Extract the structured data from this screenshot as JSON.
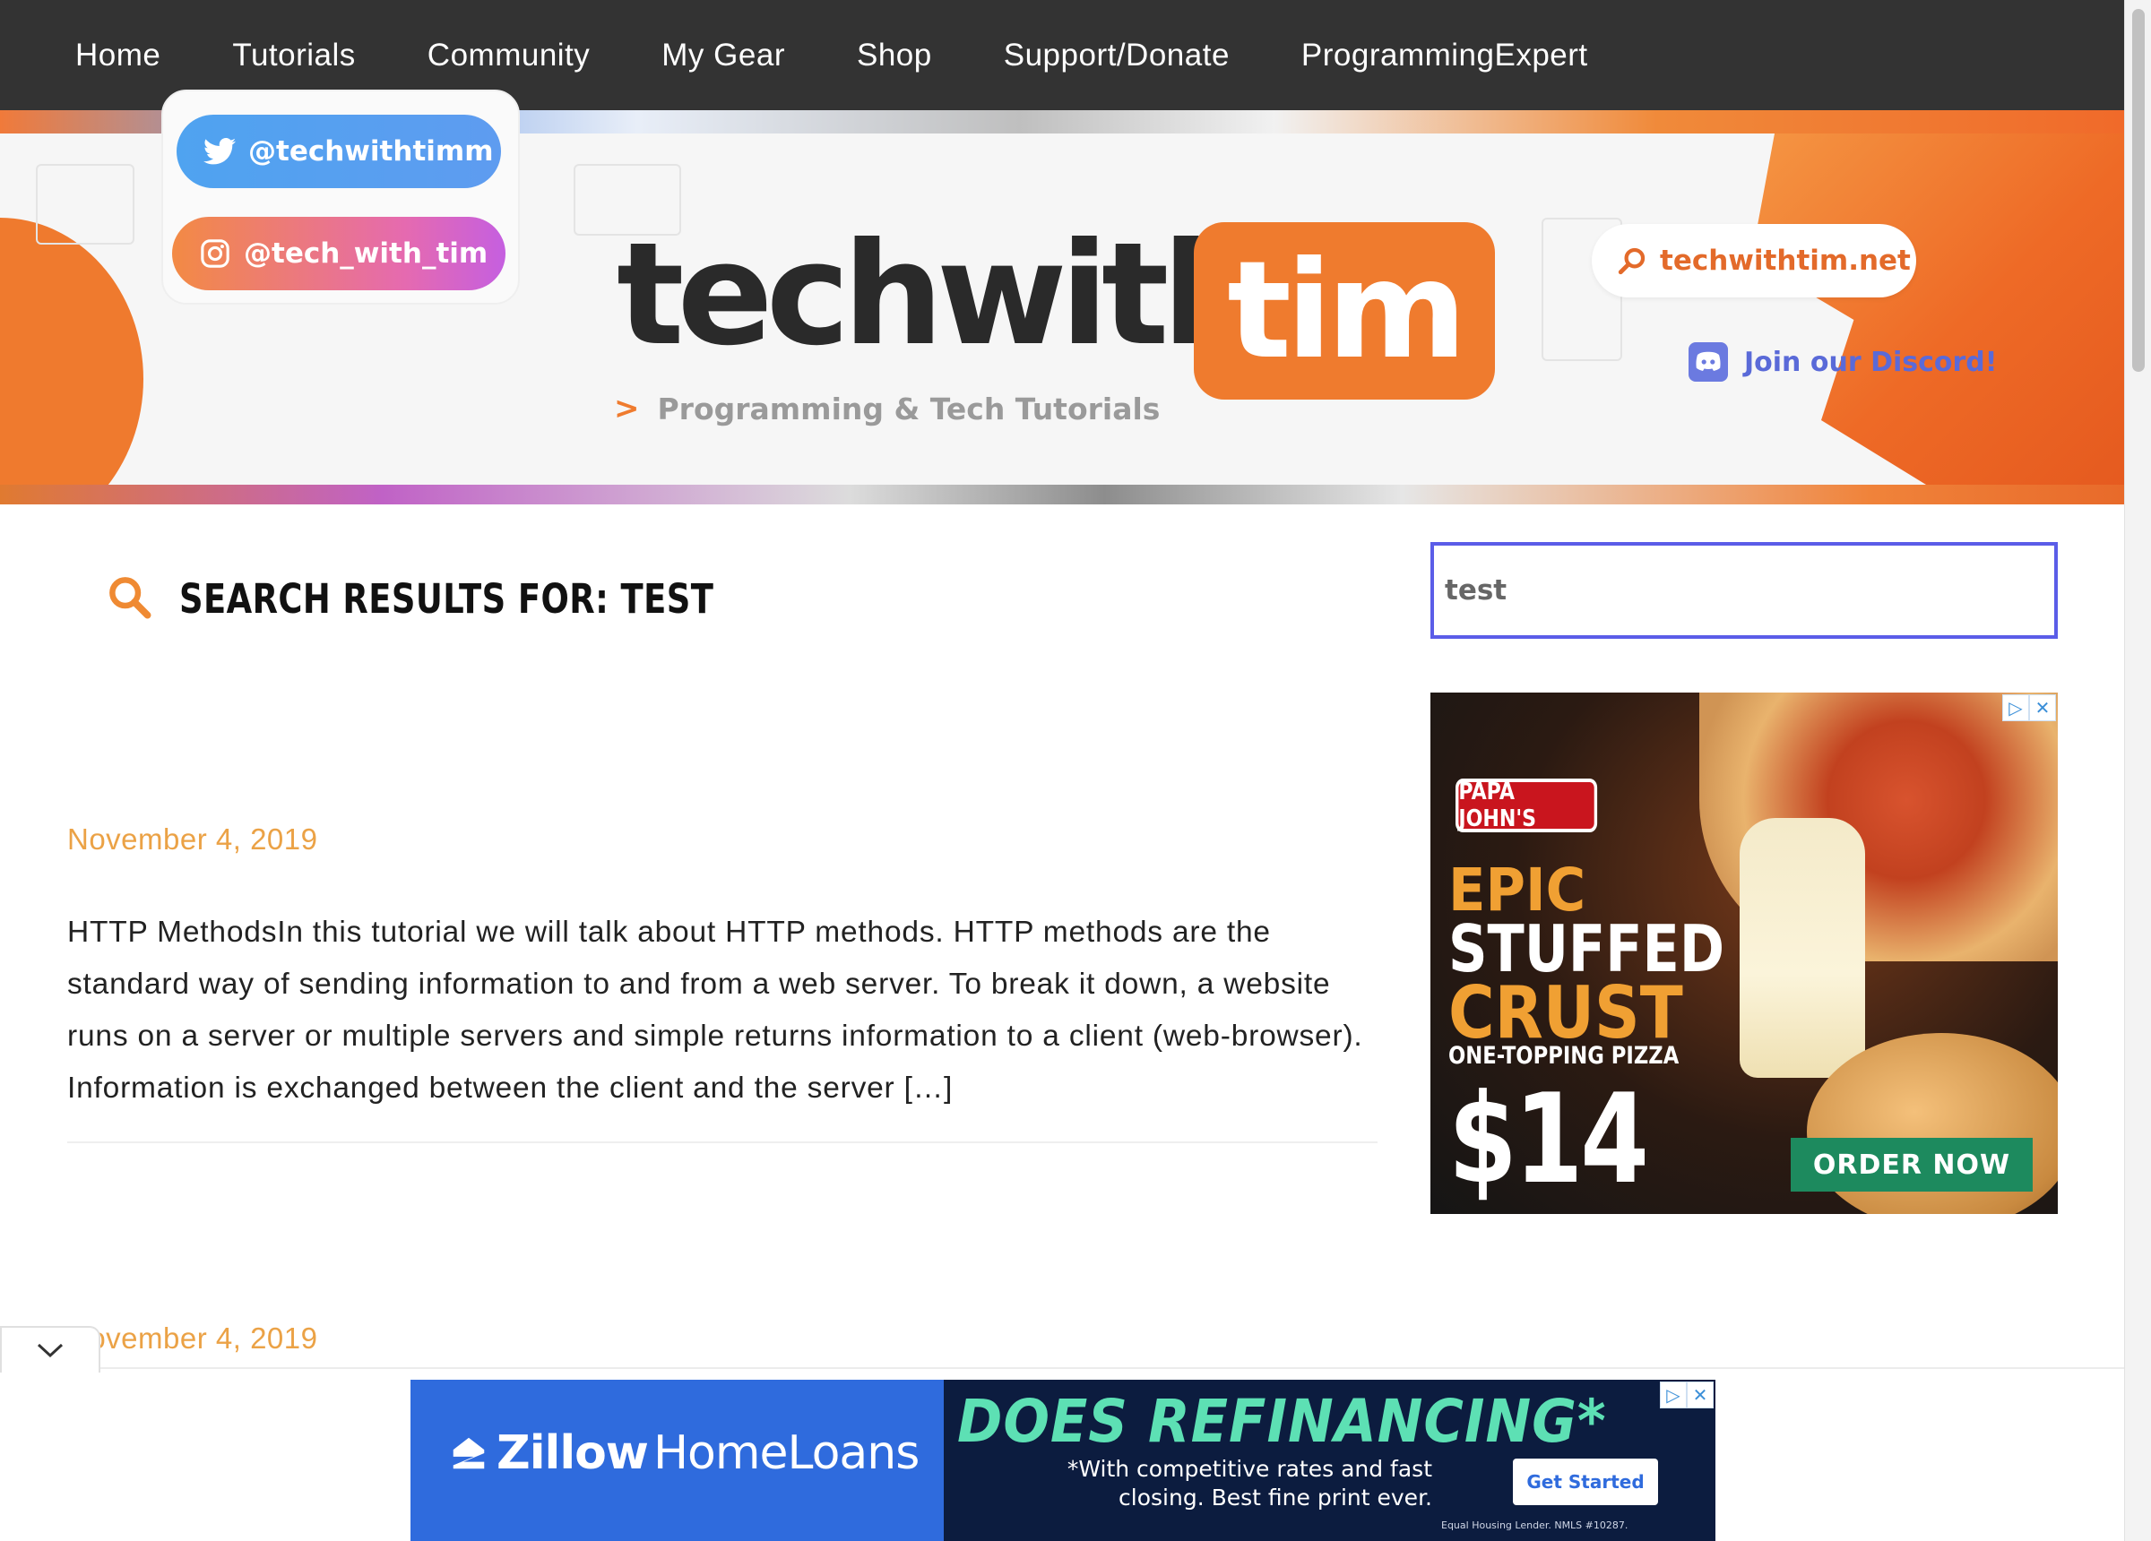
{
  "nav": {
    "items": [
      "Home",
      "Tutorials",
      "Community",
      "My Gear",
      "Shop",
      "Support/Donate",
      "ProgrammingExpert"
    ]
  },
  "banner": {
    "twitter_handle": "@techwithtimm",
    "instagram_handle": "@tech_with_tim",
    "logo_left": "techwith",
    "logo_right": "tim",
    "tagline": "Programming & Tech Tutorials",
    "website": "techwithtim.net",
    "discord": "Join our Discord!"
  },
  "main": {
    "heading": "SEARCH RESULTS FOR: TEST",
    "posts": [
      {
        "date": "November 4, 2019",
        "excerpt": "HTTP MethodsIn this tutorial we will talk about HTTP methods. HTTP methods are the standard way of sending information to and from a web server. To break it down, a website runs on a server or multiple servers and simple returns information to a client (web-browser). Information is exchanged between the client and the server […]"
      },
      {
        "date": "November 4, 2019"
      }
    ]
  },
  "sidebar": {
    "search_value": "test",
    "ad": {
      "brand": "PAPA JOHN'S",
      "line1": "EPIC",
      "line2": "STUFFED",
      "line3": "CRUST",
      "line4": "ONE-TOPPING PIZZA",
      "price": "$14",
      "cta": "ORDER NOW",
      "choices_icon": "ad-choices-icon",
      "close_icon": "close-icon"
    }
  },
  "bottom_ad": {
    "brand_bold": "Zillow",
    "brand_light": "HomeLoans",
    "headline": "DOES REFINANCING*",
    "sub": "*With competitive rates and fast closing. Best fine print ever.",
    "cta": "Get Started",
    "fine": "Equal Housing Lender. NMLS #10287."
  },
  "colors": {
    "nav_bg": "#333333",
    "accent_orange": "#ef7b2e",
    "date_color": "#eba246",
    "search_border": "#5b5de8"
  }
}
